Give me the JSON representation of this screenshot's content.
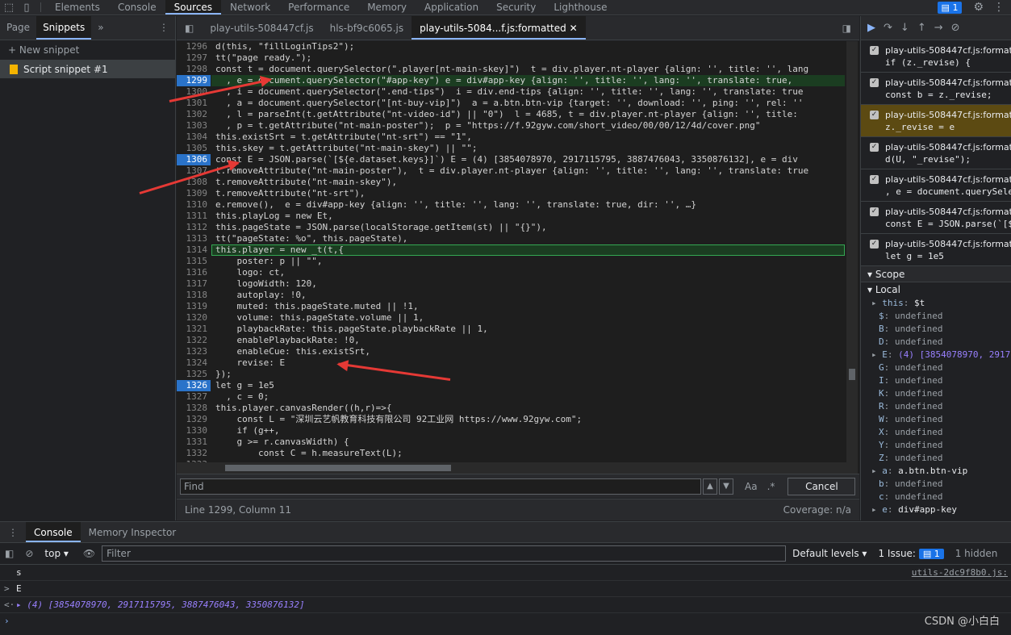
{
  "top_tabs": [
    "Elements",
    "Console",
    "Sources",
    "Network",
    "Performance",
    "Memory",
    "Application",
    "Security",
    "Lighthouse"
  ],
  "issues_badge": "1",
  "left_panel": {
    "tabs": [
      "Page",
      "Snippets"
    ],
    "new_snippet": "+ New snippet",
    "snippet": "Script snippet #1"
  },
  "editor_tabs": [
    "play-utils-508447cf.js",
    "hls-bf9c6065.js",
    "play-utils-5084...f.js:formatted"
  ],
  "code": {
    "line_numbers": [
      "1296",
      "1297",
      "1298",
      "1299",
      "1300",
      "1301",
      "1302",
      "1303",
      "1304",
      "1305",
      "1306",
      "1307",
      "1308",
      "1309",
      "1310",
      "1311",
      "1312",
      "1313",
      "1314",
      "1315",
      "1316",
      "1317",
      "1318",
      "1319",
      "1320",
      "1321",
      "1322",
      "1323",
      "1324",
      "1325",
      "1326",
      "1327",
      "1328",
      "1329",
      "1330",
      "1331",
      "1332",
      "1333"
    ],
    "breakpoints": [
      "1299",
      "1306",
      "1326"
    ],
    "lines": [
      "d(this, \"fillLoginTips2\");",
      "tt(\"page ready.\");",
      "const t = document.querySelector(\".player[nt-main-skey]\")  t = div.player.nt-player {align: '', title: '', lang",
      "  , e = document.querySelector(\"#app-key\") e = div#app-key {align: '', title: '', lang: '', translate: true,",
      "  , i = document.querySelector(\".end-tips\")  i = div.end-tips {align: '', title: '', lang: '', translate: true",
      "  , a = document.querySelector(\"[nt-buy-vip]\")  a = a.btn.btn-vip {target: '', download: '', ping: '', rel: ''",
      "  , l = parseInt(t.getAttribute(\"nt-video-id\") || \"0\")  l = 4685, t = div.player.nt-player {align: '', title:",
      "  , p = t.getAttribute(\"nt-main-poster\");  p = \"https://f.92gyw.com/short_video/00/00/12/4d/cover.png\"",
      "this.existSrt = t.getAttribute(\"nt-srt\") == \"1\",",
      "this.skey = t.getAttribute(\"nt-main-skey\") || \"\";",
      "const E = JSON.parse(`[${e.dataset.keys}]`) E = (4) [3854078970, 2917115795, 3887476043, 3350876132], e = div",
      "t.removeAttribute(\"nt-main-poster\"),  t = div.player.nt-player {align: '', title: '', lang: '', translate: true",
      "t.removeAttribute(\"nt-main-skey\"),",
      "t.removeAttribute(\"nt-srt\"),",
      "e.remove(),  e = div#app-key {align: '', title: '', lang: '', translate: true, dir: '', …}",
      "this.playLog = new Et,",
      "this.pageState = JSON.parse(localStorage.getItem(st) || \"{}\"),",
      "tt(\"pageState: %o\", this.pageState),",
      "this.player = new _t(t,{",
      "    poster: p || \"\",",
      "    logo: ct,",
      "    logoWidth: 120,",
      "    autoplay: !0,",
      "    muted: this.pageState.muted || !1,",
      "    volume: this.pageState.volume || 1,",
      "    playbackRate: this.pageState.playbackRate || 1,",
      "    enablePlaybackRate: !0,",
      "    enableCue: this.existSrt,",
      "    revise: E",
      "});",
      "let g = 1e5",
      "  , c = 0;",
      "this.player.canvasRender((h,r)=>{",
      "    const L = \"深圳云艺帆教育科技有限公司 92工业网 https://www.92gyw.com\";",
      "    if (g++,",
      "    g >= r.canvasWidth) {",
      "        const C = h.measureText(L);",
      ""
    ]
  },
  "find": {
    "placeholder": "Find",
    "aa": "Aa",
    "regex": ".*",
    "cancel": "Cancel"
  },
  "status": {
    "position": "Line 1299, Column 11",
    "coverage": "Coverage: n/a"
  },
  "breakpoints_panel": [
    {
      "file": "play-utils-508447cf.js:formatt...",
      "code": "if (z._revise) {"
    },
    {
      "file": "play-utils-508447cf.js:formatt...",
      "code": "const b = z._revise;"
    },
    {
      "file": "play-utils-508447cf.js:formatt...",
      "code": "z._revise = e"
    },
    {
      "file": "play-utils-508447cf.js:formatt...",
      "code": "d(U, \"_revise\");"
    },
    {
      "file": "play-utils-508447cf.js:formatt...",
      "code": ", e = document.querySele"
    },
    {
      "file": "play-utils-508447cf.js:formatt...",
      "code": "const E = JSON.parse(`[$"
    },
    {
      "file": "play-utils-508447cf.js:formatt...",
      "code": "let g = 1e5"
    }
  ],
  "scope": {
    "title": "Scope",
    "local": "Local",
    "vars": [
      {
        "k": "this",
        "v": "$t"
      },
      {
        "k": "$",
        "v": "undefined"
      },
      {
        "k": "B",
        "v": "undefined"
      },
      {
        "k": "D",
        "v": "undefined"
      },
      {
        "k": "E",
        "v": "(4) [3854078970, 29171"
      },
      {
        "k": "G",
        "v": "undefined"
      },
      {
        "k": "I",
        "v": "undefined"
      },
      {
        "k": "K",
        "v": "undefined"
      },
      {
        "k": "R",
        "v": "undefined"
      },
      {
        "k": "W",
        "v": "undefined"
      },
      {
        "k": "X",
        "v": "undefined"
      },
      {
        "k": "Y",
        "v": "undefined"
      },
      {
        "k": "Z",
        "v": "undefined"
      },
      {
        "k": "a",
        "v": "a.btn.btn-vip"
      },
      {
        "k": "b",
        "v": "undefined"
      },
      {
        "k": "c",
        "v": "undefined"
      },
      {
        "k": "e",
        "v": "div#app-key"
      }
    ]
  },
  "console": {
    "tabs": [
      "Console",
      "Memory Inspector"
    ],
    "context": "top",
    "filter_placeholder": "Filter",
    "levels": "Default levels",
    "issue": "1 Issue:",
    "issue_count": "1",
    "hidden": "1 hidden",
    "lines": [
      {
        "prompt": "",
        "text": "s",
        "src": "utils-2dc9f8b0.js:"
      },
      {
        "prompt": ">",
        "text": "E",
        "src": ""
      },
      {
        "prompt": "<·",
        "text": "▸ (4) [3854078970, 2917115795, 3887476043, 3350876132]",
        "src": ""
      }
    ],
    "watermark": "CSDN @小白白"
  }
}
